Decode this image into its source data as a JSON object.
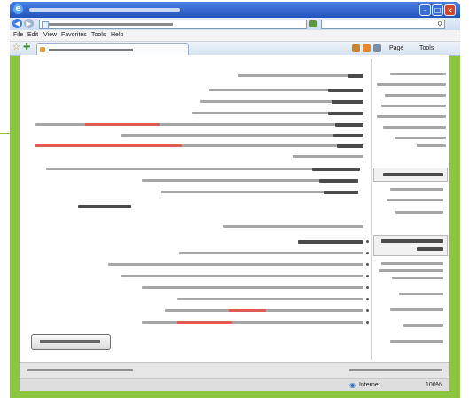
{
  "menu": {
    "items": [
      "File",
      "Edit",
      "View",
      "Favorites",
      "Tools",
      "Help"
    ]
  },
  "toolbar": {
    "page_label": "Page",
    "tools_label": "Tools"
  },
  "statusbar": {
    "zone": "Internet",
    "zoom": "100%"
  },
  "icons": {
    "browser": "ie-logo-icon",
    "back": "back-arrow-icon",
    "forward": "forward-arrow-icon",
    "search": "search-icon",
    "favorites": "star-icon",
    "add_favorite": "add-favorite-icon",
    "home": "home-icon",
    "feeds": "feeds-icon",
    "print": "print-icon",
    "zone": "globe-icon"
  },
  "colors": {
    "frame_green": "#8cc63f",
    "titlebar_blue": "#2354bd",
    "close_red": "#d2472c",
    "highlight_red": "#df5a52"
  }
}
